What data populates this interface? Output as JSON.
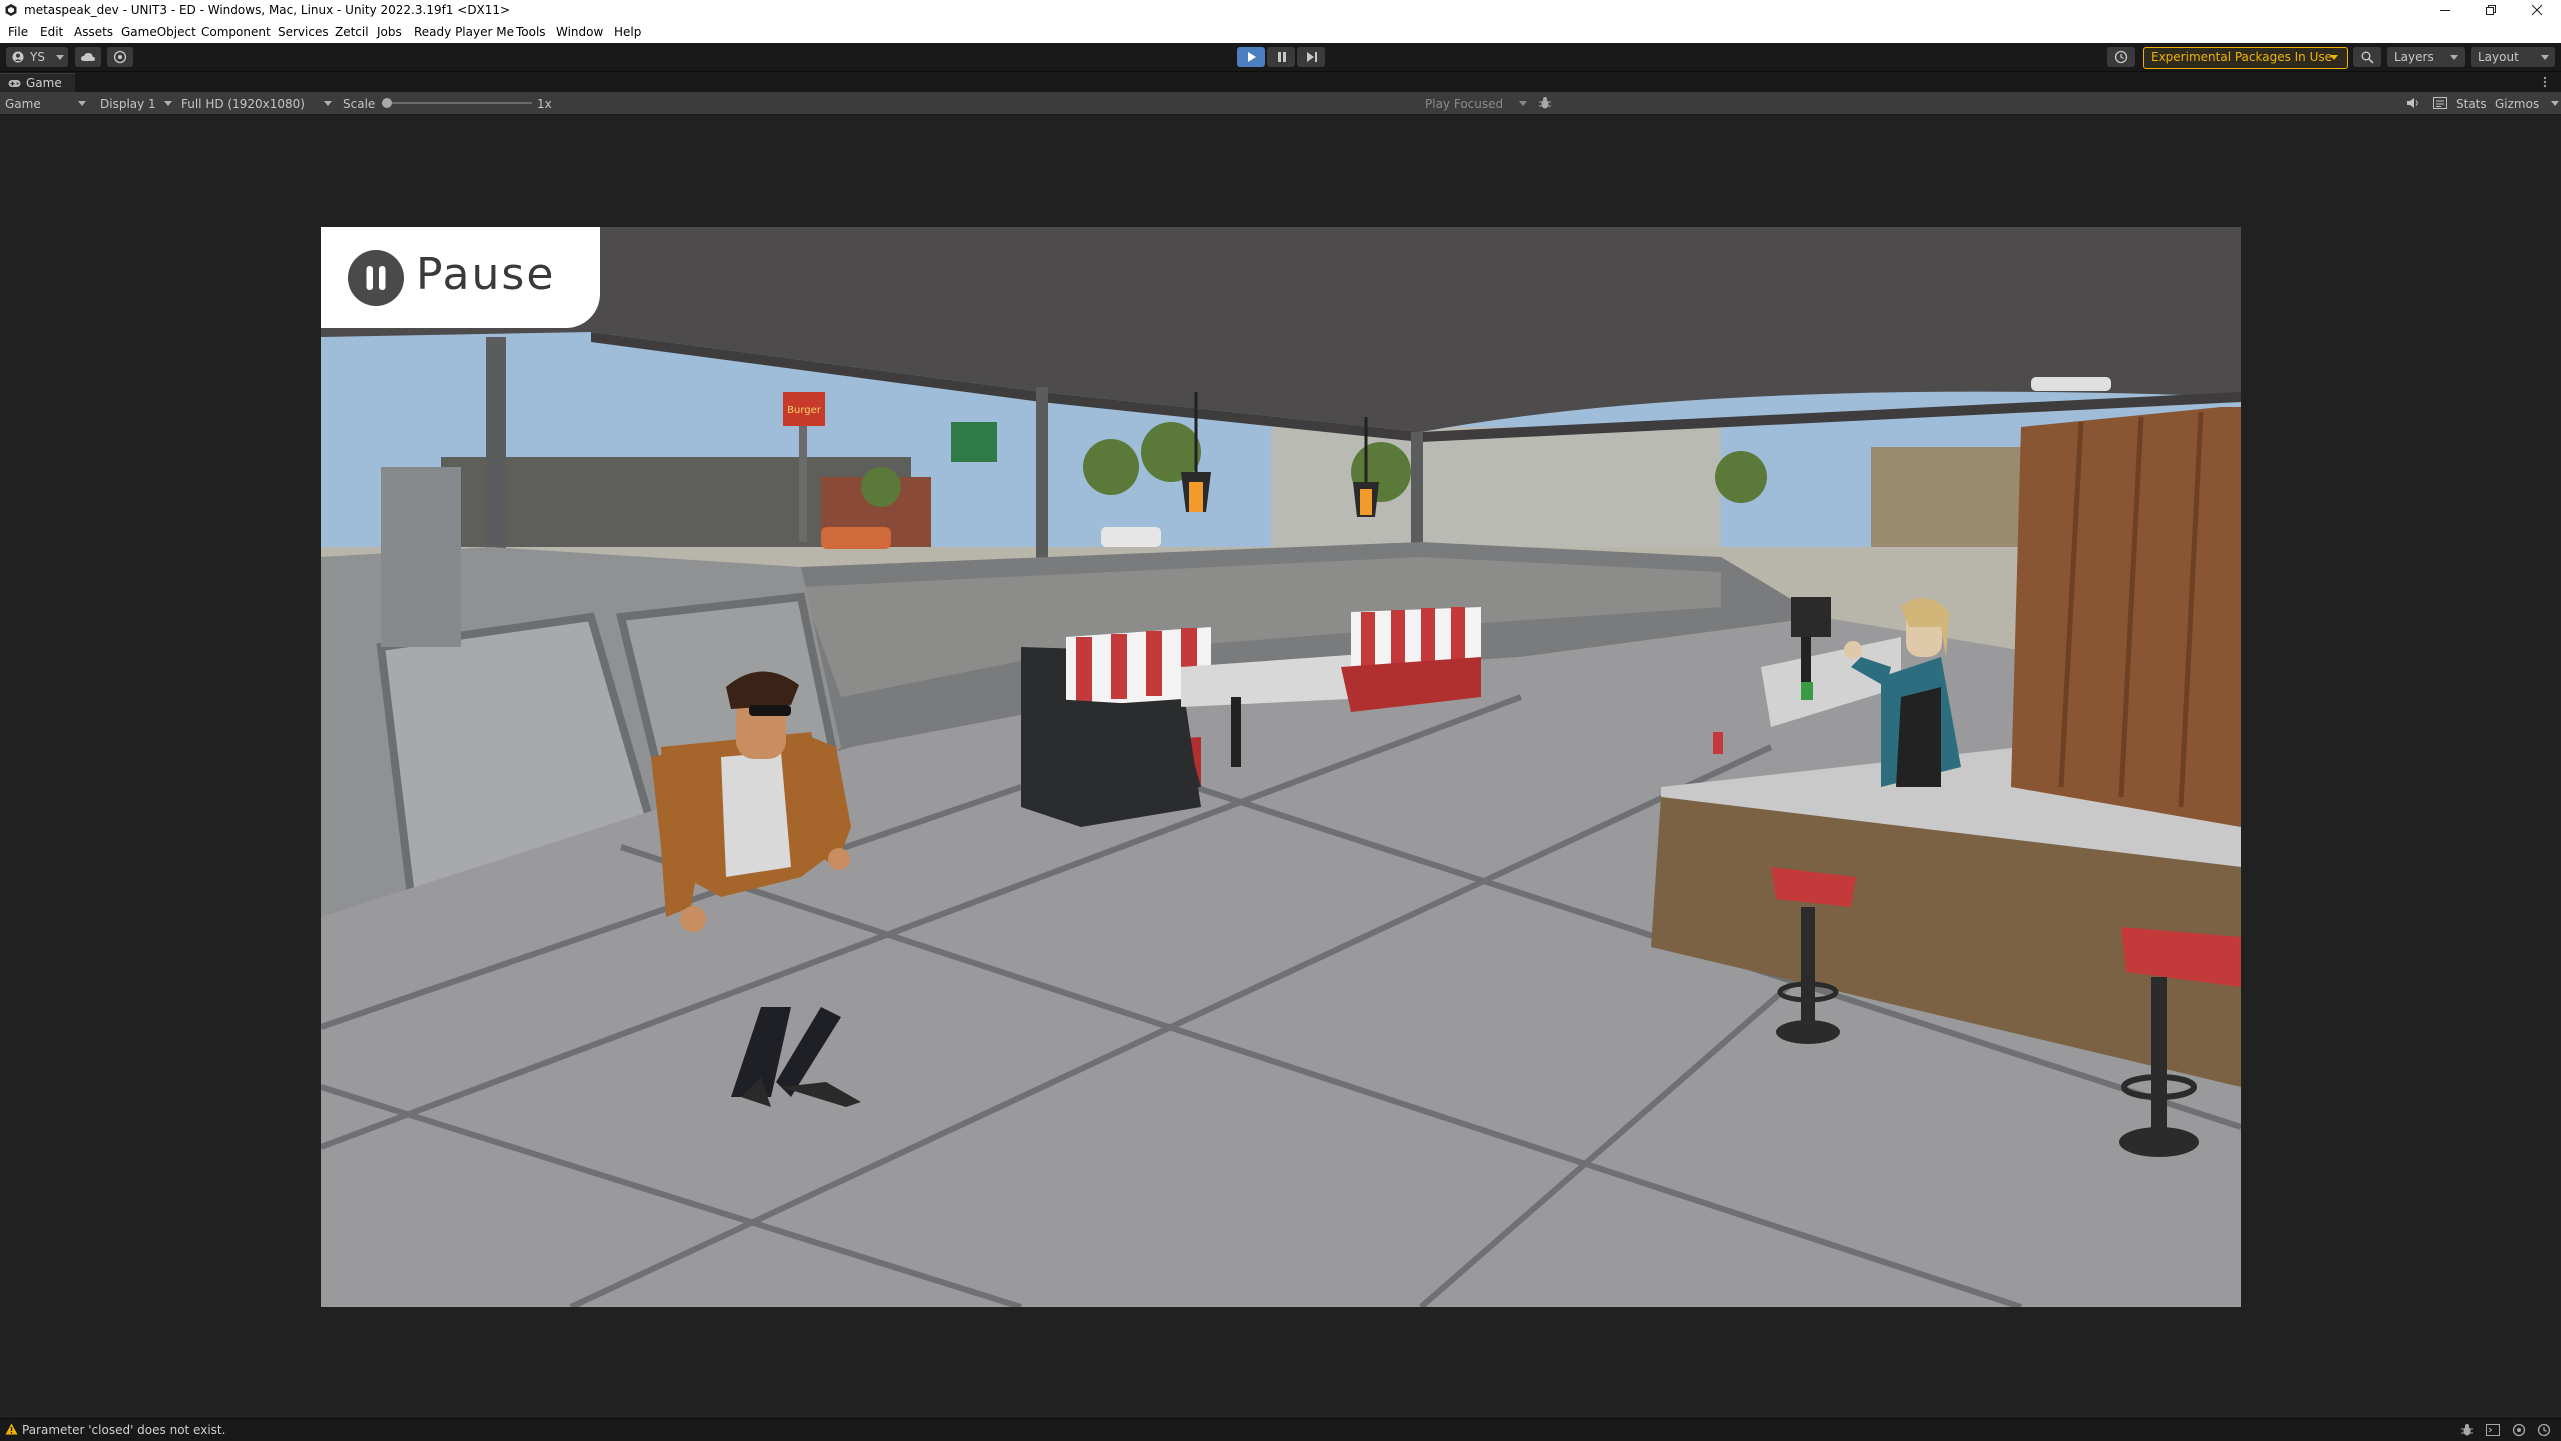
{
  "window": {
    "title": "metaspeak_dev - UNIT3 - ED - Windows, Mac, Linux - Unity 2022.3.19f1 <DX11>"
  },
  "menu": [
    "File",
    "Edit",
    "Assets",
    "GameObject",
    "Component",
    "Services",
    "Zetcil",
    "Jobs",
    "Ready Player Me",
    "Tools",
    "Window",
    "Help"
  ],
  "toolbar": {
    "account_label": "YS",
    "experimental_label": "Experimental Packages In Use",
    "layers_label": "Layers",
    "layout_label": "Layout",
    "accent_color": "#4c7fbf",
    "warning_color": "#f0b400"
  },
  "game_tab": {
    "label": "Game"
  },
  "game_toolbar": {
    "mode_select": "Game",
    "display_select": "Display 1",
    "resolution_select": "Full HD (1920x1080)",
    "scale_label": "Scale",
    "scale_value": "1x",
    "play_focus_select": "Play Focused",
    "stats_label": "Stats",
    "gizmos_label": "Gizmos"
  },
  "game": {
    "pause_label": "Pause",
    "sign_text": "Burger"
  },
  "status": {
    "message": "Parameter 'closed' does not exist."
  },
  "icons": [
    "unity-logo-icon",
    "minimize-icon",
    "maximize-icon",
    "close-icon",
    "account-icon",
    "cloud-icon",
    "collab-icon",
    "play-icon",
    "pause-icon",
    "step-icon",
    "history-icon",
    "search-icon",
    "gamepad-icon",
    "menu-dots-icon",
    "mute-icon",
    "stats-icon",
    "pause-circle-icon",
    "warning-icon",
    "bug-icon",
    "console-icon"
  ]
}
